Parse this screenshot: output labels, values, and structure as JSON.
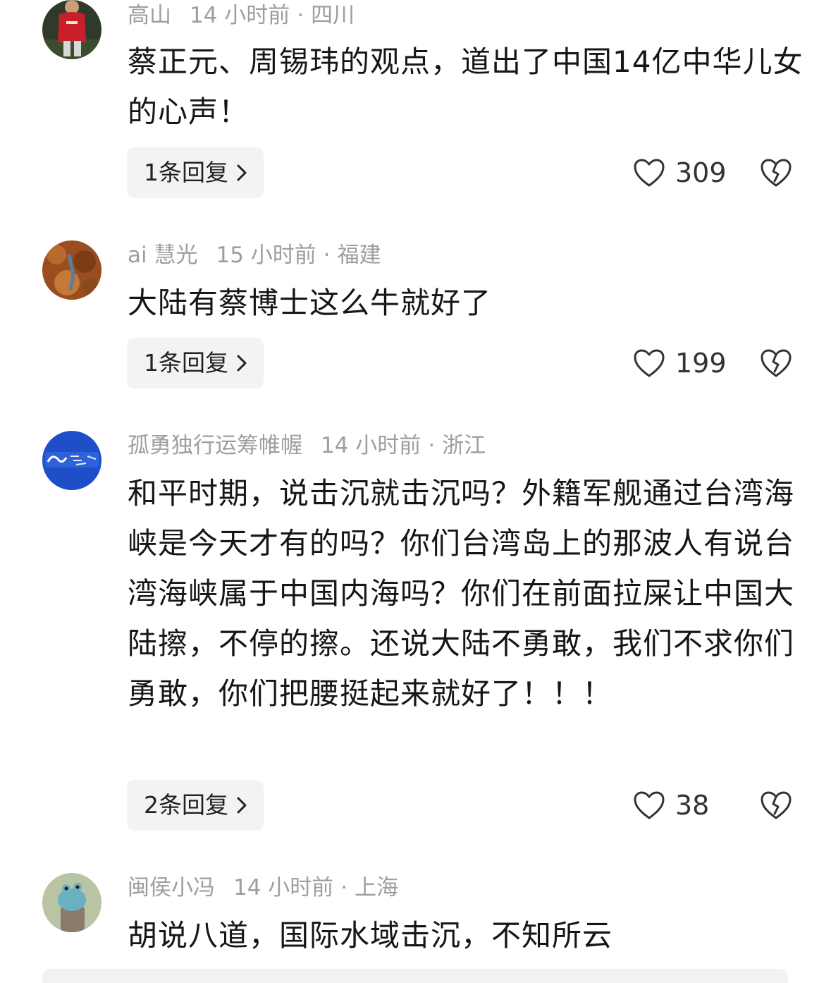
{
  "comments": [
    {
      "name": "高山",
      "time": "14 小时前",
      "dot": "·",
      "location": "四川",
      "text": "蔡正元、周锡玮的观点，道出了中国14亿中华儿女的心声！",
      "replies": "1条回复",
      "likes": "309",
      "avatar_icon": "football-player-avatar"
    },
    {
      "name": "ai 慧光",
      "time": "15 小时前",
      "dot": "·",
      "location": "福建",
      "text": "大陆有蔡博士这么牛就好了",
      "replies": "1条回复",
      "likes": "199",
      "avatar_icon": "autumn-leaves-avatar"
    },
    {
      "name": "孤勇独行运筹帷幄",
      "time": "14 小时前",
      "dot": "·",
      "location": "浙江",
      "text": "和平时期，说击沉就击沉吗？外籍军舰通过台湾海峡是今天才有的吗？你们台湾岛上的那波人有说台湾海峡属于中国内海吗？你们在前面拉屎让中国大陆擦，不停的擦。还说大陆不勇敢，我们不求你们勇敢，你们把腰挺起来就好了！！！",
      "replies": "2条回复",
      "likes": "38",
      "avatar_icon": "blue-calligraphy-avatar"
    },
    {
      "name": "闽侯小冯",
      "time": "14 小时前",
      "dot": "·",
      "location": "上海",
      "text": "胡说八道，国际水域击沉，不知所云",
      "avatar_icon": "green-creature-avatar"
    }
  ],
  "colors": {
    "meta_gray": "#9e9e9e",
    "reply_bg": "#f3f3f3",
    "text": "#161616"
  },
  "icons": {
    "like": "heart-outline-icon",
    "dislike": "broken-heart-icon",
    "reply_arrow": "chevron-right-icon"
  }
}
